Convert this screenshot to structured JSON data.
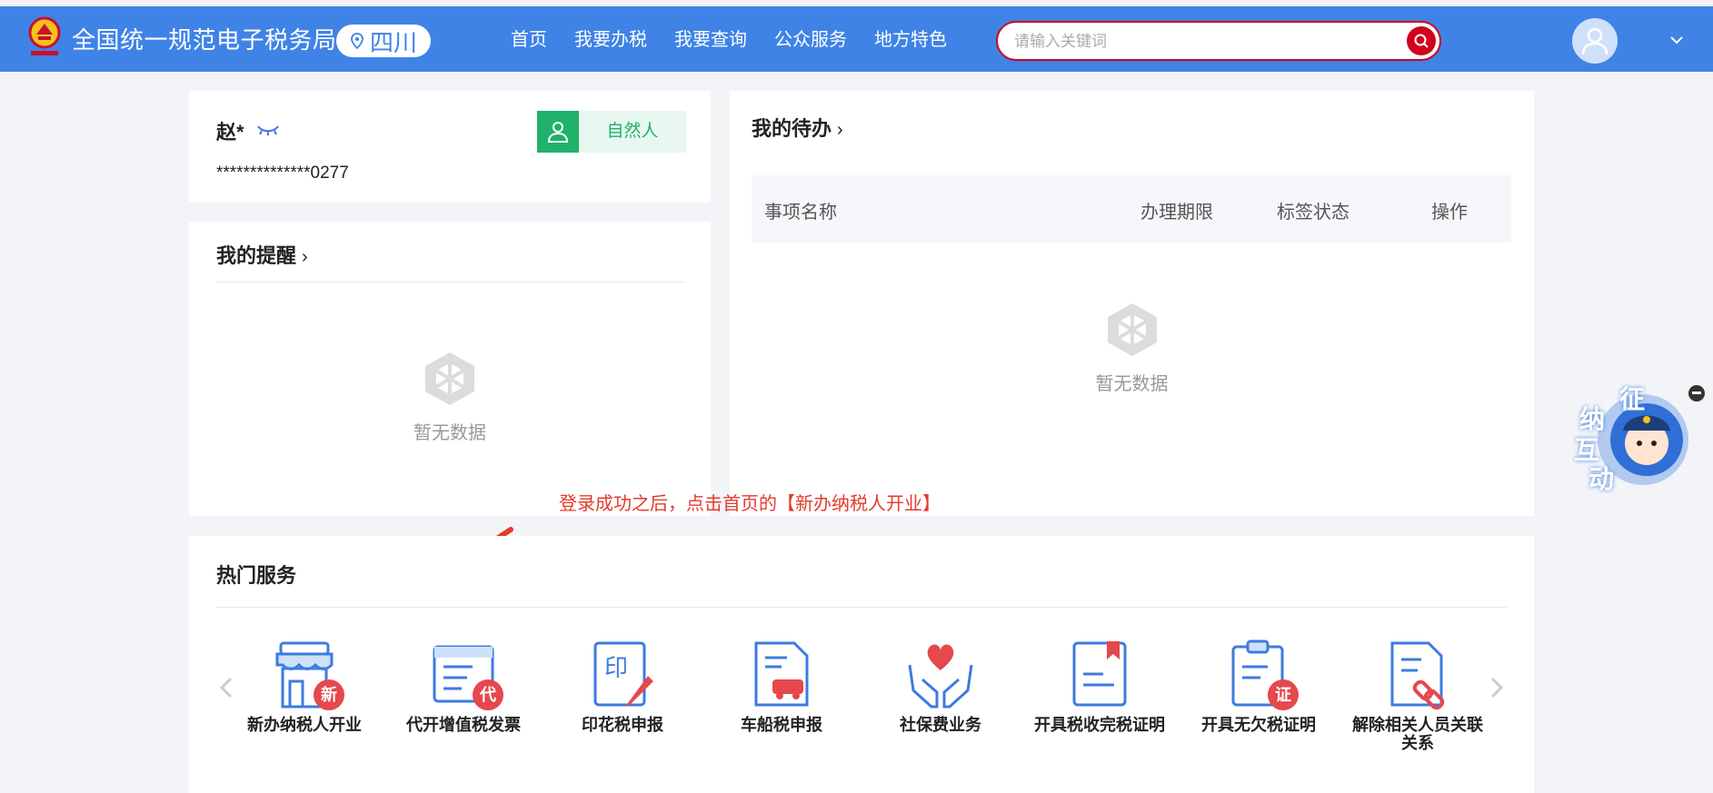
{
  "header": {
    "site_title": "全国统一规范电子税务局",
    "region": "四川",
    "nav": [
      "首页",
      "我要办税",
      "我要查询",
      "公众服务",
      "地方特色"
    ],
    "search_placeholder": "请输入关键词"
  },
  "user_card": {
    "name": "赵*",
    "id_masked": "**************0277",
    "badge_label": "自然人"
  },
  "reminder": {
    "title": "我的提醒",
    "empty_text": "暂无数据"
  },
  "todo": {
    "title": "我的待办",
    "columns": [
      "事项名称",
      "办理期限",
      "标签状态",
      "操作"
    ],
    "empty_text": "暂无数据"
  },
  "annotation": "登录成功之后，点击首页的【新办纳税人开业】",
  "hot_services": {
    "title": "热门服务",
    "items": [
      {
        "label": "新办纳税人开业",
        "tag": "新",
        "icon": "shop-icon"
      },
      {
        "label": "代开增值税发票",
        "tag": "代",
        "icon": "invoice-icon"
      },
      {
        "label": "印花税申报",
        "icon": "stamp-edit-icon"
      },
      {
        "label": "车船税申报",
        "icon": "car-document-icon"
      },
      {
        "label": "社保费业务",
        "icon": "heart-hands-icon"
      },
      {
        "label": "开具税收完税证明",
        "icon": "certificate-bookmark-icon"
      },
      {
        "label": "开具无欠税证明",
        "tag": "证",
        "icon": "clipboard-certificate-icon"
      },
      {
        "label": "解除相关人员关联关系",
        "icon": "unlink-document-icon"
      }
    ]
  },
  "mascot": {
    "text": [
      "征",
      "纳",
      "互",
      "动"
    ]
  },
  "colors": {
    "header_blue": "#3f83e6",
    "accent_red": "#d0021b",
    "badge_green": "#20b26a",
    "annotation_red": "#e53a2c",
    "icon_blue": "#3d7be0"
  }
}
